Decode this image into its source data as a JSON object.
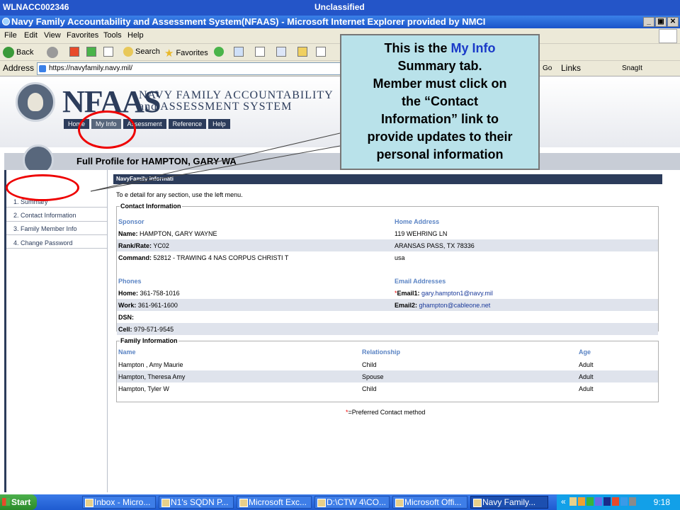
{
  "topbar": {
    "left": "WLNACC002346",
    "center": "Unclassified"
  },
  "window": {
    "title": "Navy Family Accountability and Assessment System(NFAAS) - Microsoft Internet Explorer provided by NMCI"
  },
  "menu": {
    "items": [
      "File",
      "Edit",
      "View",
      "Favorites",
      "Tools",
      "Help"
    ]
  },
  "toolbar": {
    "back": "Back",
    "search": "Search",
    "favorites": "Favorites"
  },
  "address": {
    "label": "Address",
    "url": "https://navyfamily.navy.mil/",
    "go": "Go",
    "links": "Links",
    "snagit": "SnagIt"
  },
  "header": {
    "logo_text": "NFAAS",
    "sub_line1": "NAVY FAMILY ACCOUNTABILITY",
    "sub_line2": "and ASSESSMENT SYSTEM",
    "nav": [
      "Home",
      "My Info",
      "Assessment",
      "Reference",
      "Help"
    ]
  },
  "profile": {
    "title": "Full Profile for HAMPTON, GARY WA"
  },
  "sidebar": {
    "items": [
      "1. Summary",
      "2. Contact Information",
      "3. Family Member Info",
      "4. Change Password"
    ]
  },
  "main": {
    "header": "NavyFamily Informati",
    "instruction": "To         e detail for any section, use the left menu.",
    "contact": {
      "legend": "Contact Information",
      "sponsor_h": "Sponsor",
      "home_h": "Home Address",
      "name_label": "Name:",
      "name": "HAMPTON, GARY WAYNE",
      "rank_label": "Rank/Rate:",
      "rank": "YC02",
      "command_label": "Command:",
      "command": "52812  -  TRAWING 4 NAS CORPUS CHRISTI T",
      "addr1": "119 WEHRING LN",
      "addr2": "ARANSAS PASS, TX  78336",
      "addr3": "usa",
      "phones_h": "Phones",
      "email_h": "Email Addresses",
      "home_label": "Home:",
      "home": "361-758-1016",
      "work_label": "Work:",
      "work": "361-961-1600",
      "dsn_label": "DSN:",
      "cell_label": "Cell:",
      "cell": "979-571-9545",
      "star": "*",
      "email1_label": "Email1:",
      "email1": "gary.hampton1@navy.mil",
      "email2_label": "Email2:",
      "email2": "ghampton@cableone.net"
    },
    "family": {
      "legend": "Family Information",
      "col_name": "Name",
      "col_rel": "Relationship",
      "col_age": "Age",
      "rows": [
        {
          "name": "Hampton , Amy Maurie",
          "rel": "Child",
          "age": "Adult"
        },
        {
          "name": "Hampton, Theresa Amy",
          "rel": "Spouse",
          "age": "Adult"
        },
        {
          "name": "Hampton, Tyler W",
          "rel": "Child",
          "age": "Adult"
        }
      ]
    },
    "footnote_star": "*",
    "footnote": "=Preferred Contact method"
  },
  "callout": {
    "l1_pre": "This is the ",
    "l1_blue": "My Info",
    "l2": "Summary tab.",
    "l3": "Member must click on",
    "l4": "the “Contact",
    "l5": "Information” link to",
    "l6": "provide updates to their",
    "l7": "personal information"
  },
  "taskbar": {
    "start": "Start",
    "tasks": [
      "Inbox - Micro...",
      "N1's SQDN P...",
      "Microsoft Exc...",
      "D:\\CTW 4\\CO...",
      "Microsoft Offi...",
      "Navy Family..."
    ],
    "tray_chev": "«",
    "time": "9:18"
  },
  "colors": {
    "accent": "#2c3c5b",
    "highlight_circle": "#ee0000",
    "callout_bg": "#b9e2ea",
    "sub_header_link": "#5b84c4"
  }
}
